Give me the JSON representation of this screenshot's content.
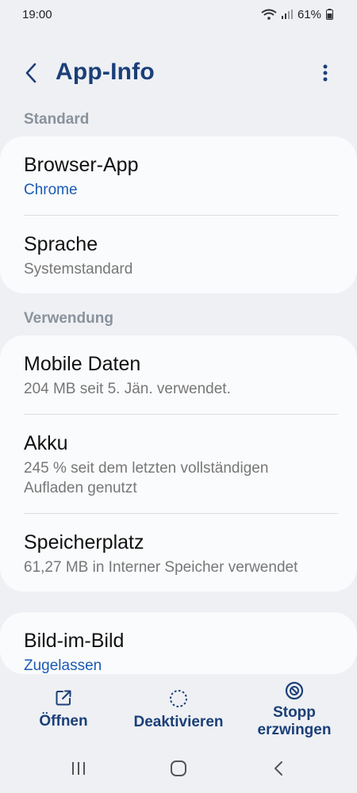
{
  "status": {
    "time": "19:00",
    "battery": "61%"
  },
  "header": {
    "title": "App-Info"
  },
  "sections": {
    "standard": "Standard",
    "usage": "Verwendung"
  },
  "standard_rows": [
    {
      "title": "Browser-App",
      "subtitle": "Chrome"
    },
    {
      "title": "Sprache",
      "subtitle": "Systemstandard"
    }
  ],
  "usage_rows": [
    {
      "title": "Mobile Daten",
      "subtitle": "204 MB seit 5. Jän. verwendet."
    },
    {
      "title": "Akku",
      "subtitle_line1": "245 % seit dem letzten vollständigen",
      "subtitle_line2": "Aufladen genutzt"
    },
    {
      "title": "Speicherplatz",
      "subtitle": "61,27 MB in Interner Speicher verwendet"
    }
  ],
  "pip_row": {
    "title": "Bild-im-Bild",
    "subtitle": "Zugelassen"
  },
  "actions": {
    "open": "Öffnen",
    "deactivate": "Deaktivieren",
    "force_stop_line1": "Stopp",
    "force_stop_line2": "erzwingen"
  },
  "colors": {
    "accent": "#1b3f78",
    "link": "#1a5bb5",
    "background": "#eef0f4",
    "card": "#fafbfc"
  },
  "icons": [
    "back-arrow-icon",
    "more-vertical-icon",
    "open-external-icon",
    "deactivate-icon",
    "force-stop-icon",
    "wifi-icon",
    "signal-icon",
    "battery-icon",
    "recents-nav-icon",
    "home-nav-icon",
    "back-nav-icon"
  ]
}
